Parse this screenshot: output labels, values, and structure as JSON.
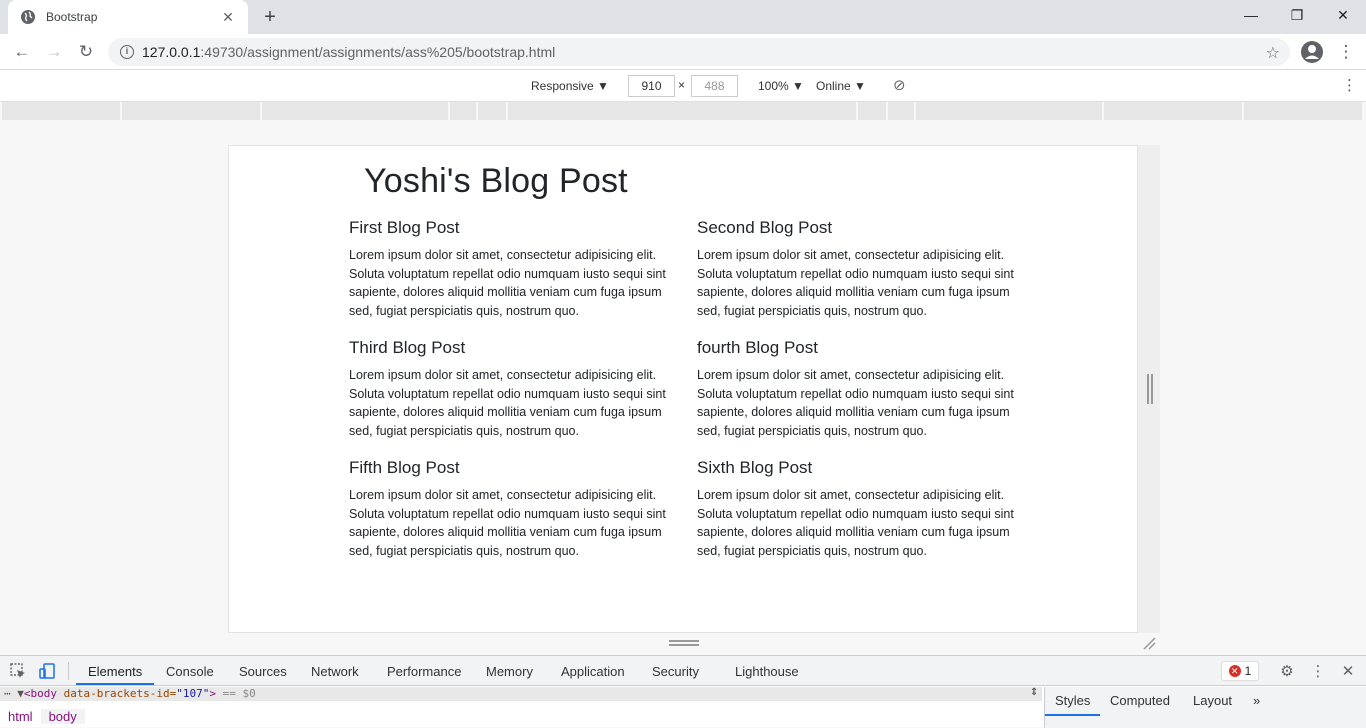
{
  "browser": {
    "tab_title": "Bootstrap",
    "url_host": "127.0.0.1",
    "url_rest": ":49730/assignment/assignments/ass%205/bootstrap.html"
  },
  "device_toolbar": {
    "mode": "Responsive",
    "width": "910",
    "height": "488",
    "times": "×",
    "zoom": "100%",
    "network": "Online"
  },
  "page": {
    "title": "Yoshi's Blog Post",
    "posts": [
      {
        "heading": "First Blog Post",
        "body": "Lorem ipsum dolor sit amet, consectetur adipisicing elit. Soluta voluptatum repellat odio numquam iusto sequi sint sapiente, dolores aliquid mollitia veniam cum fuga ipsum sed, fugiat perspiciatis quis, nostrum quo."
      },
      {
        "heading": "Second Blog Post",
        "body": "Lorem ipsum dolor sit amet, consectetur adipisicing elit. Soluta voluptatum repellat odio numquam iusto sequi sint sapiente, dolores aliquid mollitia veniam cum fuga ipsum sed, fugiat perspiciatis quis, nostrum quo."
      },
      {
        "heading": "Third Blog Post",
        "body": "Lorem ipsum dolor sit amet, consectetur adipisicing elit. Soluta voluptatum repellat odio numquam iusto sequi sint sapiente, dolores aliquid mollitia veniam cum fuga ipsum sed, fugiat perspiciatis quis, nostrum quo."
      },
      {
        "heading": "fourth Blog Post",
        "body": "Lorem ipsum dolor sit amet, consectetur adipisicing elit. Soluta voluptatum repellat odio numquam iusto sequi sint sapiente, dolores aliquid mollitia veniam cum fuga ipsum sed, fugiat perspiciatis quis, nostrum quo."
      },
      {
        "heading": "Fifth Blog Post",
        "body": "Lorem ipsum dolor sit amet, consectetur adipisicing elit. Soluta voluptatum repellat odio numquam iusto sequi sint sapiente, dolores aliquid mollitia veniam cum fuga ipsum sed, fugiat perspiciatis quis, nostrum quo."
      },
      {
        "heading": "Sixth Blog Post",
        "body": "Lorem ipsum dolor sit amet, consectetur adipisicing elit. Soluta voluptatum repellat odio numquam iusto sequi sint sapiente, dolores aliquid mollitia veniam cum fuga ipsum sed, fugiat perspiciatis quis, nostrum quo."
      }
    ]
  },
  "devtools": {
    "tabs": [
      "Elements",
      "Console",
      "Sources",
      "Network",
      "Performance",
      "Memory",
      "Application",
      "Security",
      "Lighthouse"
    ],
    "error_count": "1",
    "dom_line": {
      "tag": "<body",
      "attr": " data-brackets-id=",
      "val": "\"107\"",
      "close": ">",
      "selected": " == $0"
    },
    "breadcrumbs": [
      "html",
      "body"
    ],
    "side_tabs": [
      "Styles",
      "Computed",
      "Layout",
      "»"
    ]
  },
  "icons": {
    "back": "arrow-left-icon",
    "forward": "arrow-right-icon",
    "reload": "reload-icon",
    "bookmark": "star-icon",
    "profile": "account-icon",
    "menu": "kebab-menu-icon"
  }
}
